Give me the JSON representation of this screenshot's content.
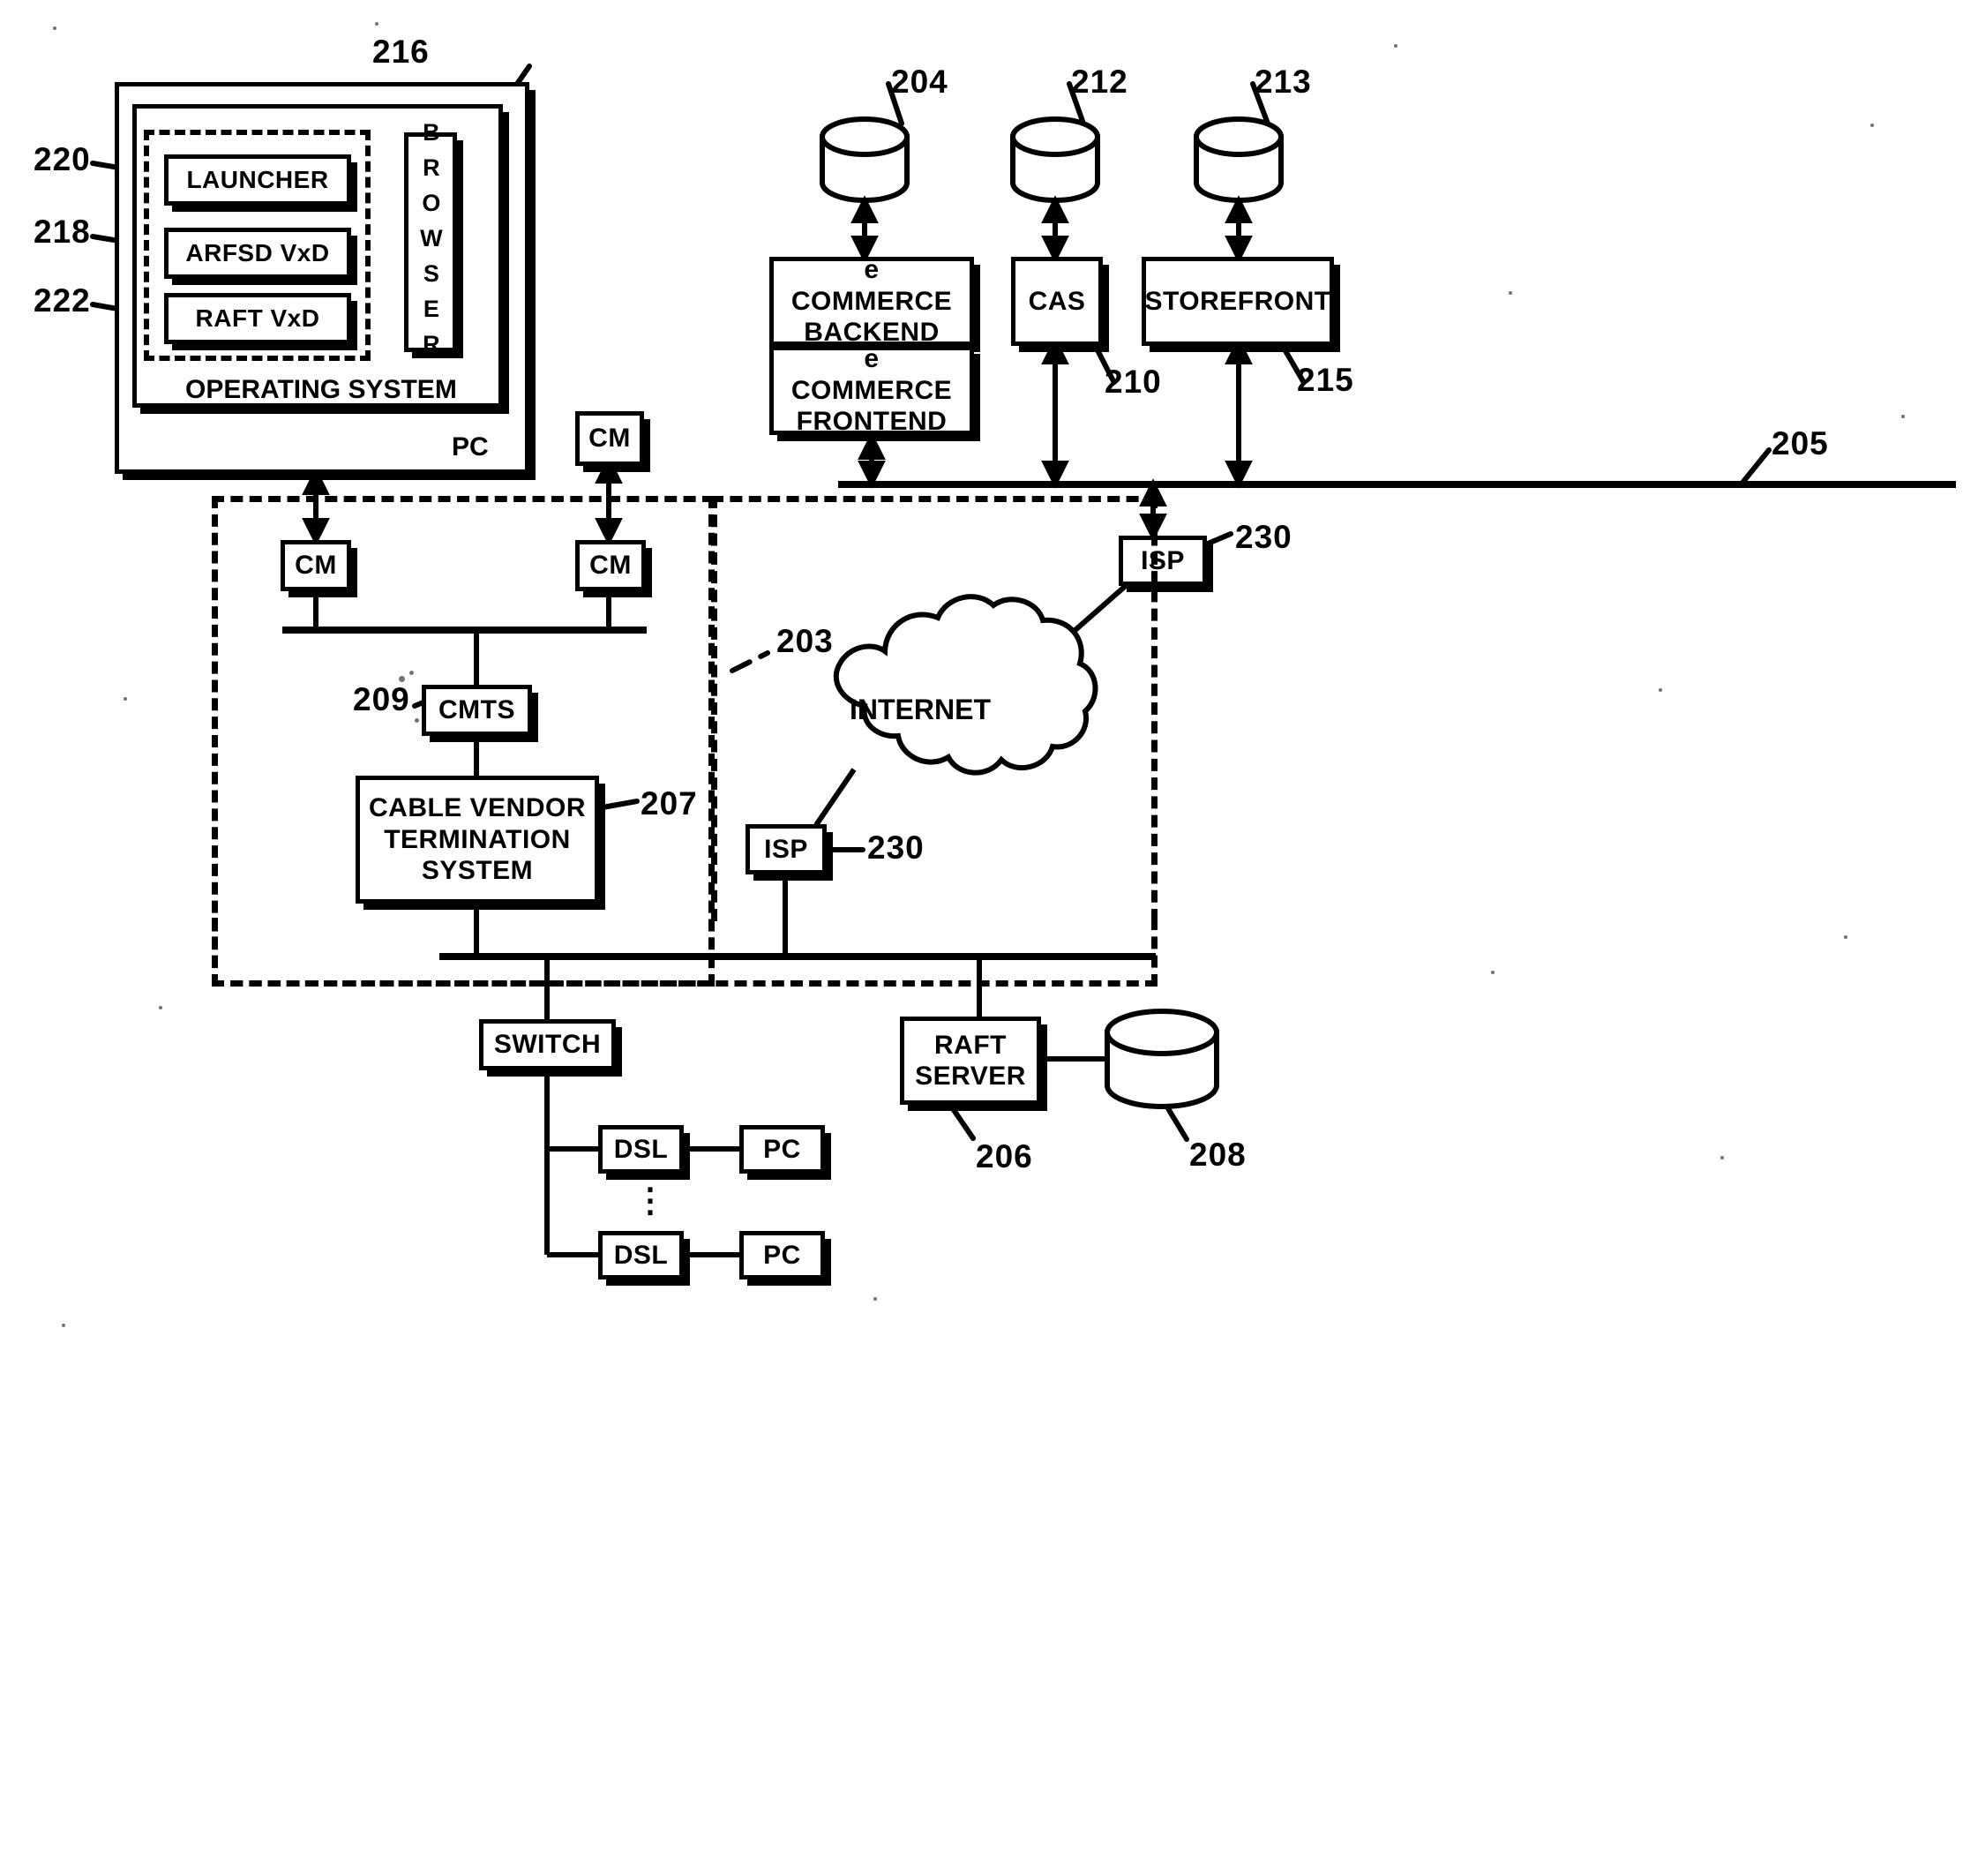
{
  "figure": {
    "type": "patent-network-diagram",
    "background": "#ffffff",
    "ink": "#000000"
  },
  "client": {
    "pc_label": "PC",
    "os_label": "OPERATING SYSTEM",
    "browser_label": "BROWSER",
    "modules": [
      {
        "label": "LAUNCHER",
        "ref": "220"
      },
      {
        "label": "ARFSD VxD",
        "ref": "218"
      },
      {
        "label": "RAFT VxD",
        "ref": "222"
      }
    ],
    "pc_ref": "216"
  },
  "refs": {
    "pc_assembly": "216",
    "launcher": "220",
    "arfsd": "218",
    "raft_vxd": "222",
    "ecommerce_db": "204",
    "cas_db": "212",
    "storefront_db": "213",
    "cas": "210",
    "storefront": "215",
    "backbone": "205",
    "isp_top": "230",
    "isp_bottom": "230",
    "access_network": "203",
    "cmts": "209",
    "cvts": "207",
    "raft_server": "206",
    "raft_storage": "208"
  },
  "servers": {
    "ecommerce_backend": "e COMMERCE BACKEND",
    "ecommerce_frontend": "e COMMERCE FRONTEND",
    "cas": "CAS",
    "storefront": "STOREFRONT"
  },
  "network": {
    "internet": "INTERNET",
    "isp": "ISP",
    "cm": "CM",
    "cmts": "CMTS",
    "cable_vendor": "CABLE VENDOR TERMINATION SYSTEM",
    "cable_vendor_lines": [
      "CABLE VENDOR",
      "TERMINATION",
      "SYSTEM"
    ],
    "switch": "SWITCH",
    "dsl": "DSL",
    "pc": "PC",
    "raft_server": "RAFT SERVER",
    "raft_server_lines": [
      "RAFT",
      "SERVER"
    ],
    "ellipsis": "⋮"
  },
  "cm_modems": [
    {
      "id": "cm-top-right",
      "label": "CM"
    },
    {
      "id": "cm-left",
      "label": "CM"
    },
    {
      "id": "cm-right",
      "label": "CM"
    }
  ],
  "dsl_rows": [
    {
      "dsl": "DSL",
      "pc": "PC"
    },
    {
      "dsl": "DSL",
      "pc": "PC"
    }
  ]
}
